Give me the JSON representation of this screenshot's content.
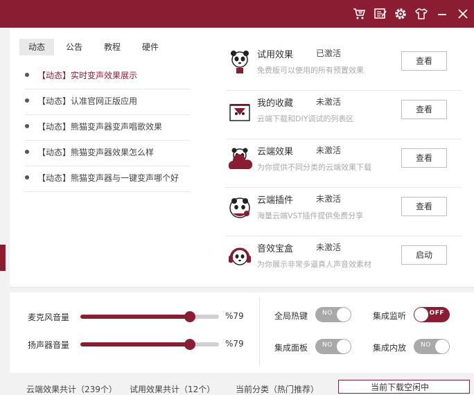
{
  "titlebar": {
    "icons": [
      "cart-icon",
      "feedback-icon",
      "settings-icon",
      "skin-icon",
      "minimize-icon",
      "close-icon"
    ]
  },
  "tabs": [
    {
      "label": "动态",
      "active": true
    },
    {
      "label": "公告",
      "active": false
    },
    {
      "label": "教程",
      "active": false
    },
    {
      "label": "硬件",
      "active": false
    }
  ],
  "news": [
    {
      "text": "【动态】实时变声效果展示"
    },
    {
      "text": "【动态】认准官网正版应用"
    },
    {
      "text": "【动态】熊猫变声器变声唱歌效果"
    },
    {
      "text": "【动态】熊猫变声器效果怎么样"
    },
    {
      "text": "【动态】熊猫变声器与一键变声哪个好"
    }
  ],
  "features": [
    {
      "name": "试用效果",
      "status": "已激活",
      "desc": "免费版可以使用的所有预置效果",
      "button": "查看",
      "icon": "panda-trial-icon"
    },
    {
      "name": "我的收藏",
      "status": "未激活",
      "desc": "云端下载和DIY调试的列表区",
      "button": "查看",
      "icon": "panda-favorites-icon"
    },
    {
      "name": "云端效果",
      "status": "未激活",
      "desc": "为你提供不同分类的云端效果下载",
      "button": "查看",
      "icon": "panda-cloud-icon"
    },
    {
      "name": "云端插件",
      "status": "未激活",
      "desc": "海量云端VST插件提供免费分享",
      "button": "查看",
      "icon": "panda-plugin-icon"
    },
    {
      "name": "音效宝盒",
      "status": "未激活",
      "desc": "为你展示非常多逼真人声音效素材",
      "button": "启动",
      "icon": "panda-headphones-icon"
    }
  ],
  "sliders": [
    {
      "label": "麦克风音量",
      "value": 79,
      "value_text": "%79"
    },
    {
      "label": "扬声器音量",
      "value": 79,
      "value_text": "%79"
    }
  ],
  "toggles": [
    {
      "label": "全局热键",
      "state": "NO",
      "on": false
    },
    {
      "label": "集成监听",
      "state": "OFF",
      "on": true
    },
    {
      "label": "集成面板",
      "state": "NO",
      "on": false
    },
    {
      "label": "集成内放",
      "state": "NO",
      "on": false
    }
  ],
  "statusbar": {
    "cloud_effects": "云端效果共计（239个）",
    "trial_effects": "试用效果共计（12个）",
    "current_category": "当前分类（热门推荐）",
    "download_status": "当前下载空闲中"
  },
  "colors": {
    "brand": "#8b1d33",
    "toggle_off": "#a9a9a9"
  }
}
